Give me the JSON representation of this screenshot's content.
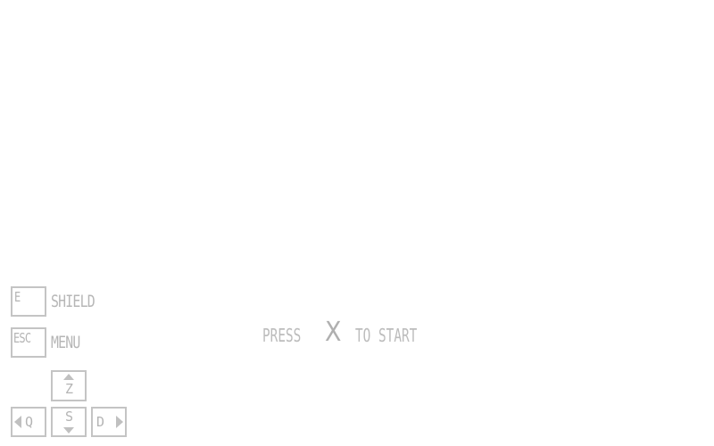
{
  "controls": {
    "shield": {
      "key": "E",
      "label": "SHIELD"
    },
    "menu": {
      "key": "ESC",
      "label": "MENU"
    },
    "movement": {
      "up": "Z",
      "down": "S",
      "left": "Q",
      "right": "D"
    }
  },
  "prompt": {
    "before": "PRESS",
    "key": "X",
    "after": "TO START"
  },
  "colors": {
    "background": "#ffffff",
    "key_border": "#c4c4c4",
    "text": "#b6b6b6"
  }
}
